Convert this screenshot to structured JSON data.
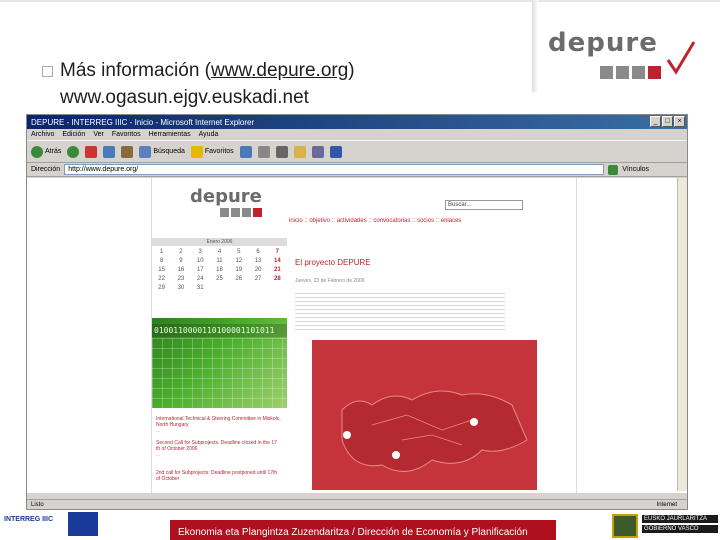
{
  "slide": {
    "bullet_prefix": "Más información (",
    "bullet_link": "www.depure.org",
    "bullet_suffix": ")",
    "second_line": "www.ogasun.ejgv.euskadi.net",
    "logo_word": "depure",
    "footer_text": "Ekonomia eta Plangintza Zuzendaritza / Dirección de Economía y Planificación",
    "footer_left_label": "INTERREG IIIC",
    "footer_right_lines": [
      "EUSKO JAURLARITZA",
      "GOBIERNO VASCO"
    ]
  },
  "browser": {
    "title": "DEPURE - INTERREG IIIC - Inicio - Microsoft Internet Explorer",
    "menu": [
      "Archivo",
      "Edición",
      "Ver",
      "Favoritos",
      "Herramientas",
      "Ayuda"
    ],
    "toolbar": {
      "back": "Atrás",
      "search": "Búsqueda",
      "favorites": "Favoritos"
    },
    "address_label": "Dirección",
    "address_value": "http://www.depure.org/",
    "links_label": "Vínculos",
    "status_left": "Listo",
    "status_right": "Internet"
  },
  "site": {
    "logo_word": "depure",
    "calendar_title": "Enero 2006",
    "calendar_days": [
      "1",
      "2",
      "3",
      "4",
      "5",
      "6",
      "7",
      "8",
      "9",
      "10",
      "11",
      "12",
      "13",
      "14",
      "15",
      "16",
      "17",
      "18",
      "19",
      "20",
      "21",
      "22",
      "23",
      "24",
      "25",
      "26",
      "27",
      "28",
      "29",
      "30",
      "31"
    ],
    "binary_text": "0100110000110100001101011",
    "search_placeholder": "Buscar...",
    "nav": "inicio :: objetivo :: actividades :: convocatorias :: socios :: enlaces",
    "article_title": "El proyecto DEPURE",
    "article_date": "Jueves, 23 de Febrero de 2006",
    "news": [
      "International Technical & Steering Committee in Miskolc, North Hungary",
      "Second Call for Subprojects. Deadline closed in the 17 th of October 2006",
      "2nd call for Subprojects: Deadline postponed until 17th of October"
    ]
  },
  "colors": {
    "brand_red": "#c0212f",
    "footer_red": "#b0101e",
    "logo_gray": "#6b6b6b"
  }
}
